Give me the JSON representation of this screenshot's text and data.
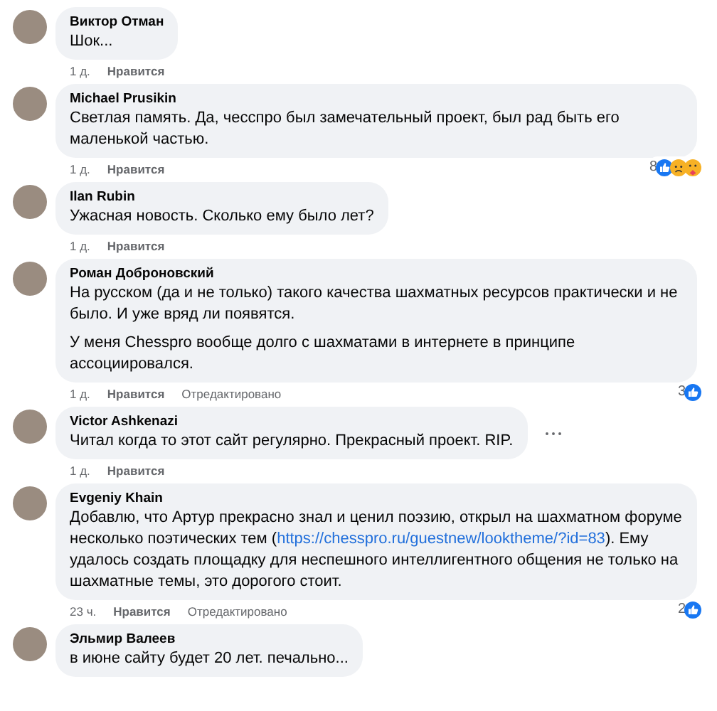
{
  "comments": [
    {
      "author": "Виктор Отман",
      "paragraphs": [
        [
          {
            "text": "Шок..."
          }
        ]
      ],
      "time": "1 д.",
      "like": "Нравится",
      "more_button": false
    },
    {
      "author": "Michael Prusikin",
      "paragraphs": [
        [
          {
            "text": "Светлая память. Да, чесспро был замечательный проект, был рад быть его маленькой частью."
          }
        ]
      ],
      "time": "1 д.",
      "like": "Нравится",
      "more_button": false,
      "reaction_count": "8",
      "reactions": [
        {
          "kind": "like"
        },
        {
          "kind": "sad"
        },
        {
          "kind": "care"
        }
      ]
    },
    {
      "author": "Ilan Rubin",
      "paragraphs": [
        [
          {
            "text": "Ужасная новость. Сколько ему было лет?"
          }
        ]
      ],
      "time": "1 д.",
      "like": "Нравится",
      "more_button": false
    },
    {
      "author": "Роман Доброновский",
      "paragraphs": [
        [
          {
            "text": "На русском (да и не только) такого качества шахматных ресурсов практически и не было. И уже вряд ли появятся."
          }
        ],
        [
          {
            "text": "У меня Chesspro вообще долго с шахматами в интернете в принципе ассоциировался."
          }
        ]
      ],
      "time": "1 д.",
      "like": "Нравится",
      "edited": "Отредактировано",
      "more_button": false,
      "reaction_count": "3",
      "reactions": [
        {
          "kind": "like"
        }
      ]
    },
    {
      "author": "Victor Ashkenazi",
      "paragraphs": [
        [
          {
            "text": "Читал когда то этот сайт регулярно. Прекрасный проект. RIP."
          }
        ]
      ],
      "time": "1 д.",
      "like": "Нравится",
      "more_button": true
    },
    {
      "author": "Evgeniy Khain",
      "paragraphs": [
        [
          {
            "text": "Добавлю, что Артур прекрасно знал и ценил поэзию, открыл на шахматном форуме несколько поэтических тем ("
          },
          {
            "text": "https://chesspro.ru/guestnew/looktheme/?",
            "kind": "link"
          },
          {
            "text": "id=83",
            "kind": "link"
          },
          {
            "text": "). Ему удалось создать площадку для неспешного интеллигентного общения не только на шахматные темы, это дорогого стоит."
          }
        ]
      ],
      "time": "23 ч.",
      "like": "Нравится",
      "edited": "Отредактировано",
      "more_button": false,
      "reaction_count": "2",
      "reactions": [
        {
          "kind": "like"
        }
      ]
    },
    {
      "author": "Эльмир Валеев",
      "paragraphs": [
        [
          {
            "text": "в июне сайту будет 20 лет. печально..."
          }
        ]
      ],
      "more_button": false
    }
  ]
}
